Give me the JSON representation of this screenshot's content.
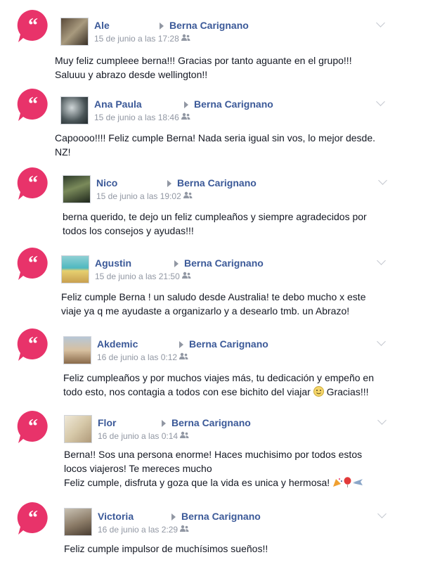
{
  "posts": [
    {
      "author": "Ale",
      "target": "Berna Carignano",
      "time": "15 de junio a las 17:28",
      "lines": [
        "Muy feliz cumpleee berna!!! Gracias por tanto aguante en el grupo!!!",
        "Saluuu y abrazo desde wellington!!"
      ]
    },
    {
      "author": "Ana Paula",
      "target": "Berna Carignano",
      "time": "15 de junio a las 18:46",
      "lines": [
        "Capoooo!!!! Feliz cumple Berna! Nada seria igual sin vos, lo mejor desde.",
        "NZ!"
      ]
    },
    {
      "author": "Nico",
      "target": "Berna Carignano",
      "time": "15 de junio a las 19:02",
      "lines": [
        "berna querido, te dejo un feliz cumpleaños y siempre agradecidos por",
        "todos los consejos y ayudas!!!"
      ]
    },
    {
      "author": "Agustin",
      "target": "Berna Carignano",
      "time": "15 de junio a las 21:50",
      "lines": [
        "Feliz cumple Berna ! un saludo desde Australia! te debo mucho x este",
        "viaje ya q me ayudaste a organizarlo y a desearlo tmb. un Abrazo!"
      ]
    },
    {
      "author": "Akdemic",
      "target": "Berna Carignano",
      "time": "16 de junio a las 0:12",
      "lines": [
        "Feliz cumpleaños y por muchos viajes más, tu dedicación y empeño en",
        "todo esto, nos contagia a todos con ese bichito del viajar",
        "Gracias!!!"
      ]
    },
    {
      "author": "Flor",
      "target": "Berna Carignano",
      "time": "16 de junio a las 0:14",
      "lines": [
        "Berna!! Sos una persona enorme! Haces muchisimo por todos estos",
        "locos viajeros! Te mereces mucho",
        "Feliz cumple, disfruta y goza que la vida es unica y hermosa!"
      ]
    },
    {
      "author": "Victoria",
      "target": "Berna Carignano",
      "time": "16 de junio a las 2:29",
      "lines": [
        "Feliz cumple impulsor de muchísimos sueños!!"
      ]
    }
  ]
}
